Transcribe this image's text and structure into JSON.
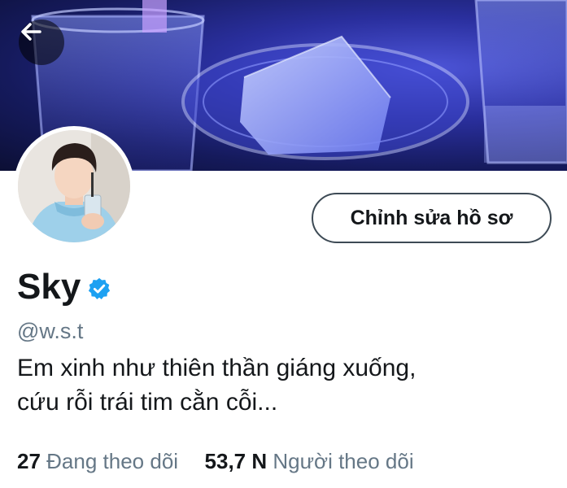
{
  "header": {
    "back_icon": "arrow-left-icon",
    "banner_desc": "banner-image"
  },
  "profile": {
    "edit_button_label": "Chỉnh sửa hồ sơ",
    "name": "Sky",
    "verified_icon": "verified-badge-icon",
    "handle": "@w.s.t",
    "bio_line1": "Em xinh như thiên thần giáng xuống,",
    "bio_line2": "cứu rỗi trái tim cằn cỗi..."
  },
  "stats": {
    "following_count": "27",
    "following_label": "Đang theo dõi",
    "followers_count": "53,7 N",
    "followers_label": "Người theo dõi"
  },
  "colors": {
    "verified": "#1da1f2",
    "secondary_text": "#657786",
    "primary_text": "#14171a"
  }
}
